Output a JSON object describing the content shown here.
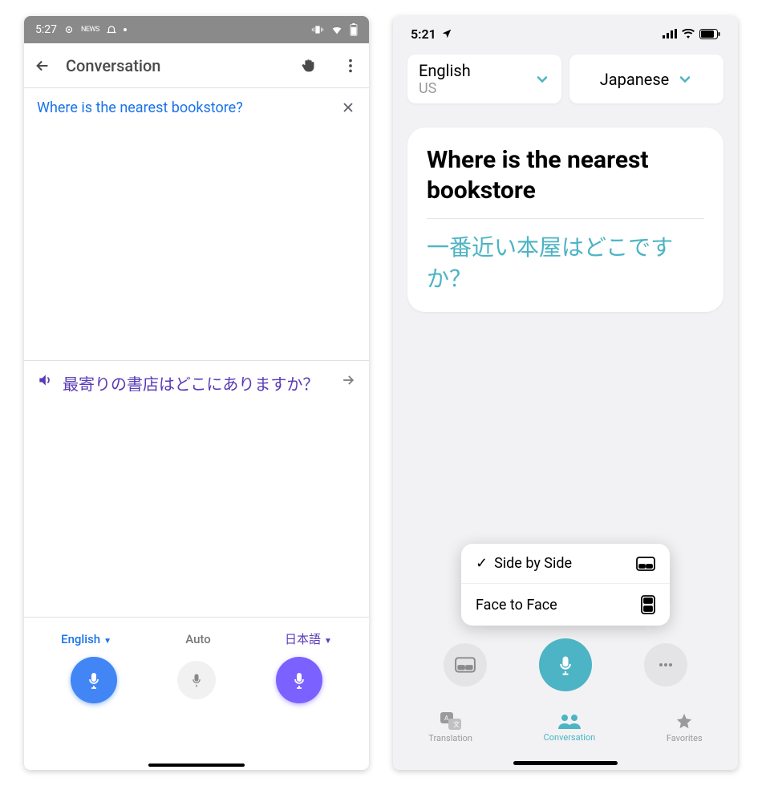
{
  "android": {
    "status_time": "5:27",
    "appbar_title": "Conversation",
    "source_text": "Where is the nearest bookstore?",
    "translated_text": "最寄りの書店はどこにありますか？",
    "lang_source": "English",
    "lang_auto": "Auto",
    "lang_target": "日本語"
  },
  "ios": {
    "status_time": "5:21",
    "lang_source_main": "English",
    "lang_source_sub": "US",
    "lang_target_main": "Japanese",
    "bubble_source": "Where is the nearest bookstore",
    "bubble_target": "一番近い本屋はどこですか？",
    "popup_item1": "Side by Side",
    "popup_item2": "Face to Face",
    "tab1": "Translation",
    "tab2": "Conversation",
    "tab3": "Favorites"
  }
}
